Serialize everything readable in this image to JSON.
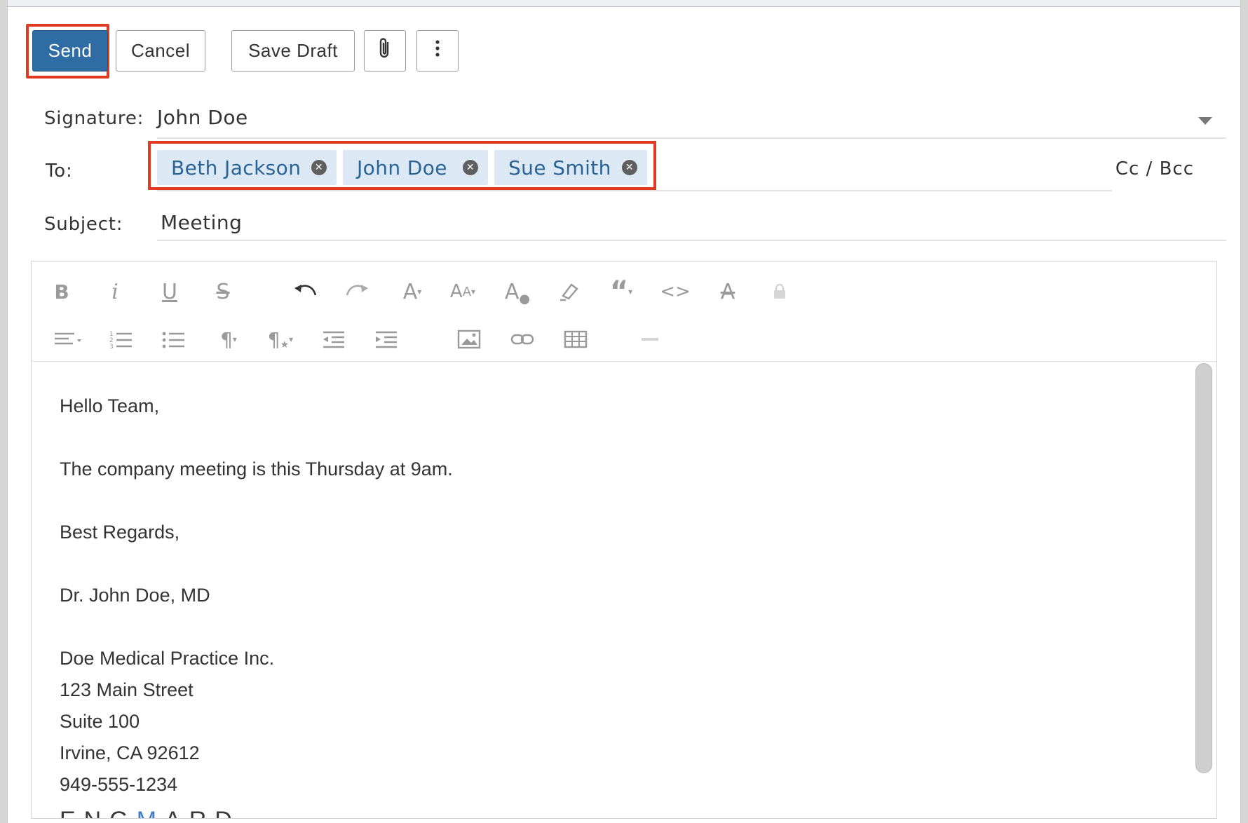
{
  "toolbar": {
    "send_label": "Send",
    "cancel_label": "Cancel",
    "save_draft_label": "Save Draft",
    "attach_icon": "paperclip-icon",
    "more_icon": "more-vertical-icon"
  },
  "fields": {
    "signature_label": "Signature:",
    "signature_value": "John Doe",
    "to_label": "To:",
    "recipients": [
      "Beth Jackson",
      "John Doe",
      "Sue Smith"
    ],
    "cc_bcc_label": "Cc / Bcc",
    "subject_label": "Subject:",
    "subject_value": "Meeting"
  },
  "editor": {
    "toolbar_row1": [
      "bold-icon",
      "italic-icon",
      "underline-icon",
      "strikethrough-icon",
      "undo-icon",
      "redo-icon",
      "font-family-icon",
      "font-size-icon",
      "text-color-icon",
      "highlight-icon",
      "quote-icon",
      "code-icon",
      "clear-format-icon",
      "lock-icon"
    ],
    "toolbar_row2": [
      "align-icon",
      "ordered-list-icon",
      "unordered-list-icon",
      "paragraph-format-icon",
      "paragraph-style-icon",
      "outdent-icon",
      "indent-icon",
      "insert-image-icon",
      "insert-link-icon",
      "insert-table-icon",
      "horizontal-rule-icon"
    ],
    "body": {
      "greeting": "Hello Team,",
      "message": "The company meeting is this Thursday at 9am.",
      "closing": "Best Regards,",
      "name": "Dr. John Doe, MD",
      "company": "Doe Medical Practice Inc.",
      "street": "123 Main Street",
      "suite": "Suite 100",
      "city": "Irvine, CA 92612",
      "phone": "949-555-1234",
      "logo_text_a": "ENG",
      "logo_text_b": "M",
      "logo_text_c": "ARD"
    }
  },
  "colors": {
    "primary": "#2f6ca3",
    "chip_bg": "#dce9f5",
    "chip_text": "#2a6496",
    "highlight": "#e03a22"
  }
}
